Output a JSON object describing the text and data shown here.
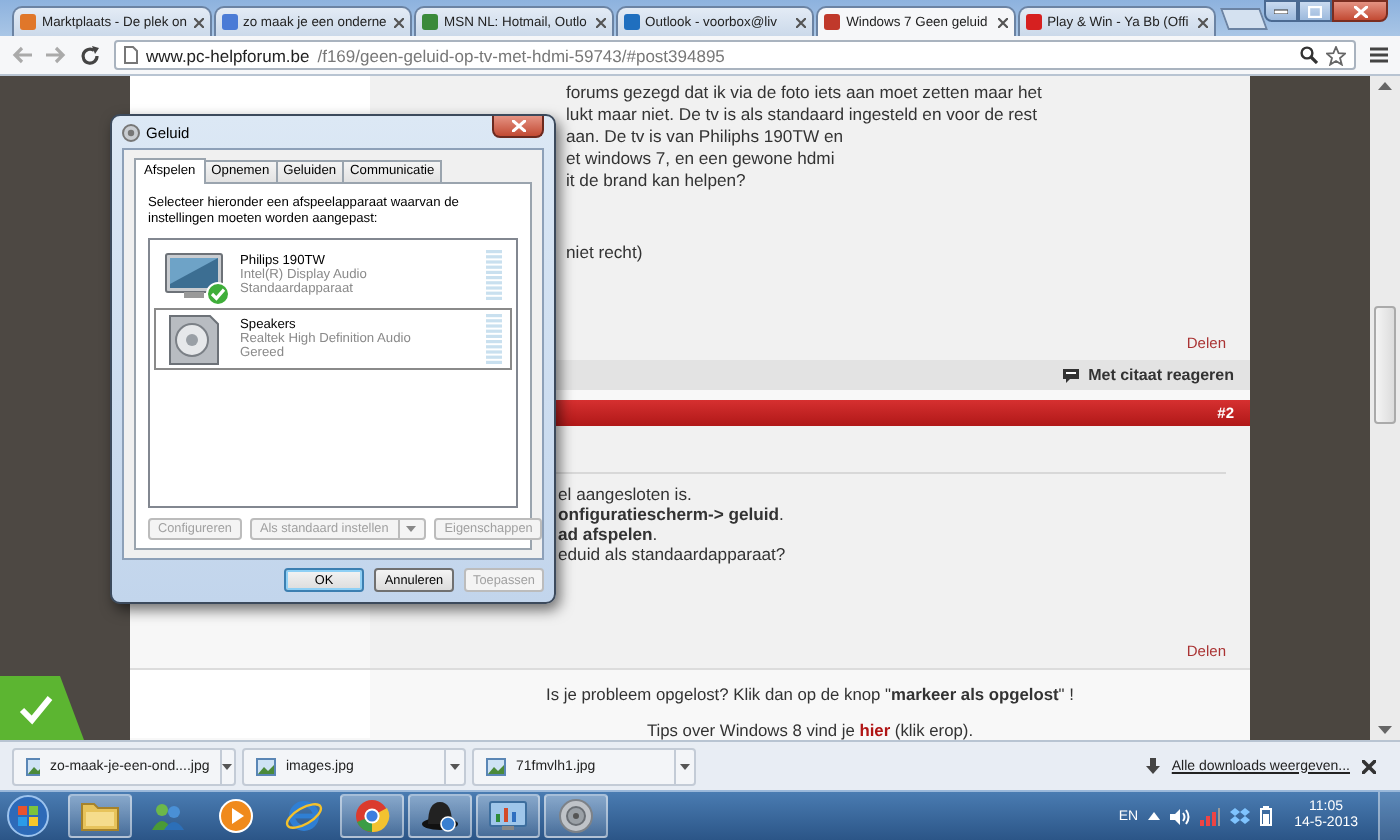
{
  "browser": {
    "tabs": [
      {
        "title": "Marktplaats - De plek on",
        "selected": false
      },
      {
        "title": "zo maak je een onderne",
        "selected": false
      },
      {
        "title": "MSN NL: Hotmail, Outlo",
        "selected": false
      },
      {
        "title": "Outlook - voorbox@liv",
        "selected": false
      },
      {
        "title": "Windows 7 Geen geluid",
        "selected": true
      },
      {
        "title": "Play & Win - Ya Bb (Offi",
        "selected": false
      }
    ],
    "url_host": "www.pc-helpforum.be",
    "url_path": "/f169/geen-geluid-op-tv-met-hdmi-59743/#post394895"
  },
  "forum": {
    "post1": {
      "lines": [
        "forums gezegd dat ik via de foto iets aan moet zetten maar het",
        "lukt maar niet. De tv is als standaard ingesteld en voor de rest",
        "aan. De tv is van Philiphs 190TW en",
        "et windows 7, en een gewone hdmi",
        "it de brand kan helpen?"
      ],
      "note": "niet recht)",
      "share": "Delen",
      "quote": "Met citaat reageren"
    },
    "post2": {
      "number": "#2",
      "lines": [
        "el aangesloten is.",
        "**onfiguratiescherm-> geluid**.",
        "**ad afspelen**.",
        "eduid als standaardapparaat?"
      ],
      "share": "Delen"
    },
    "footer": {
      "solved": "Is je probleem opgelost? Klik dan op de knop \"**markeer als opgelost**\" !",
      "tips_before": "Tips over Windows 8 vind je ",
      "tips_link": "hier",
      "tips_after": " (klik erop)."
    }
  },
  "dialog": {
    "title": "Geluid",
    "tabs": [
      {
        "label": "Afspelen",
        "selected": true
      },
      {
        "label": "Opnemen",
        "selected": false
      },
      {
        "label": "Geluiden",
        "selected": false
      },
      {
        "label": "Communicatie",
        "selected": false
      }
    ],
    "instruction": "Selecteer hieronder een afspeelapparaat waarvan de instellingen moeten worden aangepast:",
    "devices": [
      {
        "kind": "monitor",
        "name": "Philips 190TW",
        "driver": "Intel(R) Display Audio",
        "status": "Standaardapparaat",
        "default": true,
        "selected": false
      },
      {
        "kind": "speaker",
        "name": "Speakers",
        "driver": "Realtek High Definition Audio",
        "status": "Gereed",
        "default": false,
        "selected": true
      }
    ],
    "buttons": [
      {
        "kind": "plain",
        "label": "Configureren",
        "disabled": true
      },
      {
        "kind": "split",
        "label": "Als standaard instellen",
        "disabled": true
      },
      {
        "kind": "plain",
        "label": "Eigenschappen",
        "disabled": true
      }
    ],
    "footer_buttons": [
      {
        "label": "OK",
        "default": true,
        "disabled": false
      },
      {
        "label": "Annuleren",
        "default": false,
        "disabled": false
      },
      {
        "label": "Toepassen",
        "default": false,
        "disabled": true
      }
    ]
  },
  "downloads": {
    "items": [
      "zo-maak-je-een-ond....jpg",
      "images.jpg",
      "71fmvlh1.jpg"
    ],
    "show_all": "Alle downloads weergeven..."
  },
  "taskbar": {
    "apps": [
      {
        "kind": "folder",
        "running": true
      },
      {
        "kind": "people",
        "running": false
      },
      {
        "kind": "media",
        "running": false
      },
      {
        "kind": "ie",
        "running": false
      },
      {
        "kind": "chrome",
        "running": true
      },
      {
        "kind": "hat",
        "running": true
      },
      {
        "kind": "panel",
        "running": true
      },
      {
        "kind": "sound",
        "running": true
      }
    ],
    "language": "EN",
    "time": "11:05",
    "date": "14-5-2013"
  }
}
